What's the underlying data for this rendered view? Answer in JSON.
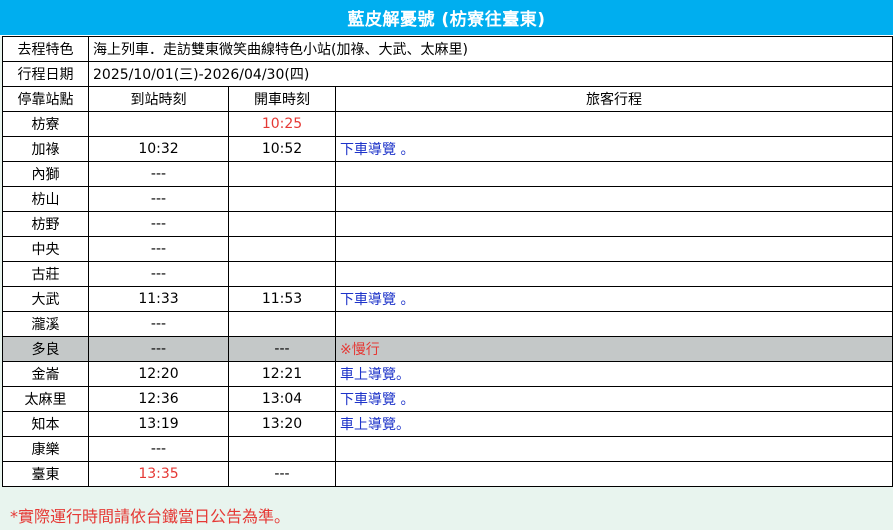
{
  "title": "藍皮解憂號 (枋寮往臺東)",
  "info": [
    {
      "label": "去程特色",
      "value": "海上列車．走訪雙東微笑曲線特色小站(加祿、大武、太麻里)"
    },
    {
      "label": "行程日期",
      "value": "2025/10/01(三)-2026/04/30(四)"
    }
  ],
  "headers": [
    "停靠站點",
    "到站時刻",
    "開車時刻",
    "旅客行程"
  ],
  "rows": [
    {
      "station": "枋寮",
      "arrive": "",
      "depart": "10:25",
      "note": ""
    },
    {
      "station": "加祿",
      "arrive": "10:32",
      "depart": "10:52",
      "note": "下車導覽 。"
    },
    {
      "station": "內獅",
      "arrive": "---",
      "depart": "",
      "note": ""
    },
    {
      "station": "枋山",
      "arrive": "---",
      "depart": "",
      "note": ""
    },
    {
      "station": "枋野",
      "arrive": "---",
      "depart": "",
      "note": ""
    },
    {
      "station": "中央",
      "arrive": "---",
      "depart": "",
      "note": ""
    },
    {
      "station": "古莊",
      "arrive": "---",
      "depart": "",
      "note": ""
    },
    {
      "station": "大武",
      "arrive": "11:33",
      "depart": "11:53",
      "note": "下車導覽 。"
    },
    {
      "station": "瀧溪",
      "arrive": "---",
      "depart": "",
      "note": ""
    },
    {
      "station": "多良",
      "arrive": "---",
      "depart": "---",
      "note": "※慢行"
    },
    {
      "station": "金崙",
      "arrive": "12:20",
      "depart": "12:21",
      "note": "車上導覽。"
    },
    {
      "station": "太麻里",
      "arrive": "12:36",
      "depart": "13:04",
      "note": "下車導覽 。"
    },
    {
      "station": "知本",
      "arrive": "13:19",
      "depart": "13:20",
      "note": "車上導覽。"
    },
    {
      "station": "康樂",
      "arrive": "---",
      "depart": "",
      "note": ""
    },
    {
      "station": "臺東",
      "arrive": "13:35",
      "depart": "---",
      "note": ""
    }
  ],
  "footer": "*實際運行時間請依台鐵當日公告為準。",
  "colors": {
    "title_bg": "#00aeef",
    "highlight_red": "#e53935",
    "note_blue": "#1d33c9",
    "slow_row_bg": "#c4c8c8"
  }
}
